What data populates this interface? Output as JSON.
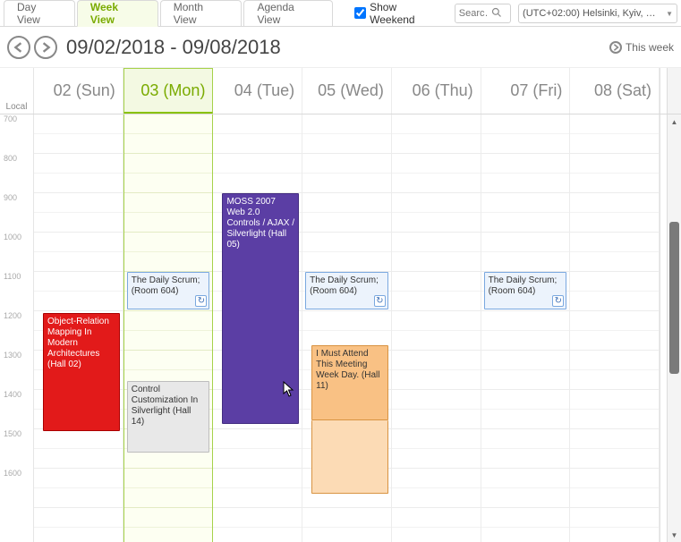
{
  "toolbar": {
    "tabs": {
      "day": "Day View",
      "week": "Week View",
      "month": "Month View",
      "agenda": "Agenda View"
    },
    "show_weekend_label": "Show Weekend",
    "show_weekend_checked": true,
    "search_placeholder": "Searc…",
    "timezone_label": "(UTC+02:00) Helsinki, Kyiv, Riga,"
  },
  "header": {
    "date_range": "09/02/2018 - 09/08/2018",
    "this_week_label": "This week"
  },
  "time_gutter": {
    "tz_name": "Local",
    "hours": [
      "700",
      "800",
      "900",
      "1000",
      "1100",
      "1200",
      "1300",
      "1400",
      "1500",
      "1600"
    ]
  },
  "days": [
    {
      "label": "02 (Sun)",
      "is_today": false
    },
    {
      "label": "03 (Mon)",
      "is_today": true
    },
    {
      "label": "04 (Tue)",
      "is_today": false
    },
    {
      "label": "05 (Wed)",
      "is_today": false
    },
    {
      "label": "06 (Thu)",
      "is_today": false
    },
    {
      "label": "07 (Fri)",
      "is_today": false
    },
    {
      "label": "08 (Sat)",
      "is_today": false
    }
  ],
  "events": {
    "sun_object_relation": "Object-Relation Mapping In Modern Architectures (Hall 02)",
    "mon_scrum": "The Daily Scrum; (Room 604)",
    "mon_control": "Control Customization In Silverlight (Hall 14)",
    "tue_moss": "MOSS 2007 Web 2.0 Controls / AJAX / Silverlight (Hall 05)",
    "wed_scrum": "The Daily Scrum; (Room 604)",
    "wed_meeting": "I Must Attend This Meeting Week Day. (Hall 11)",
    "fri_scrum": "The Daily Scrum; (Room 604)"
  }
}
